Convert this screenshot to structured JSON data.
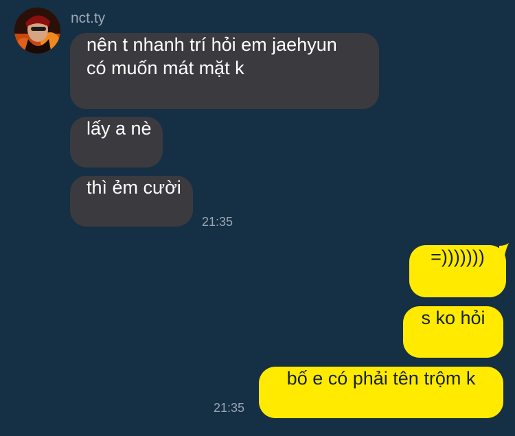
{
  "chat": {
    "sender_name": "nct.ty",
    "incoming": [
      {
        "lines": [
          "nên t nhanh trí hỏi em jaehyun",
          "có muốn mát mặt k"
        ]
      },
      {
        "lines": [
          "lấy a nè"
        ]
      },
      {
        "lines": [
          "thì ẻm cười"
        ]
      }
    ],
    "incoming_timestamp": "21:35",
    "outgoing": [
      {
        "text": "=)))))))"
      },
      {
        "text": "s ko hỏi"
      },
      {
        "text": "bố e có phải tên trộm k"
      }
    ],
    "outgoing_timestamp": "21:35"
  },
  "colors": {
    "background": "#152f45",
    "incoming_bubble": "#3b3a3e",
    "outgoing_bubble": "#ffea00",
    "timestamp_text": "#9aa7b2"
  },
  "icons": {
    "avatar": "avatar-photo"
  }
}
